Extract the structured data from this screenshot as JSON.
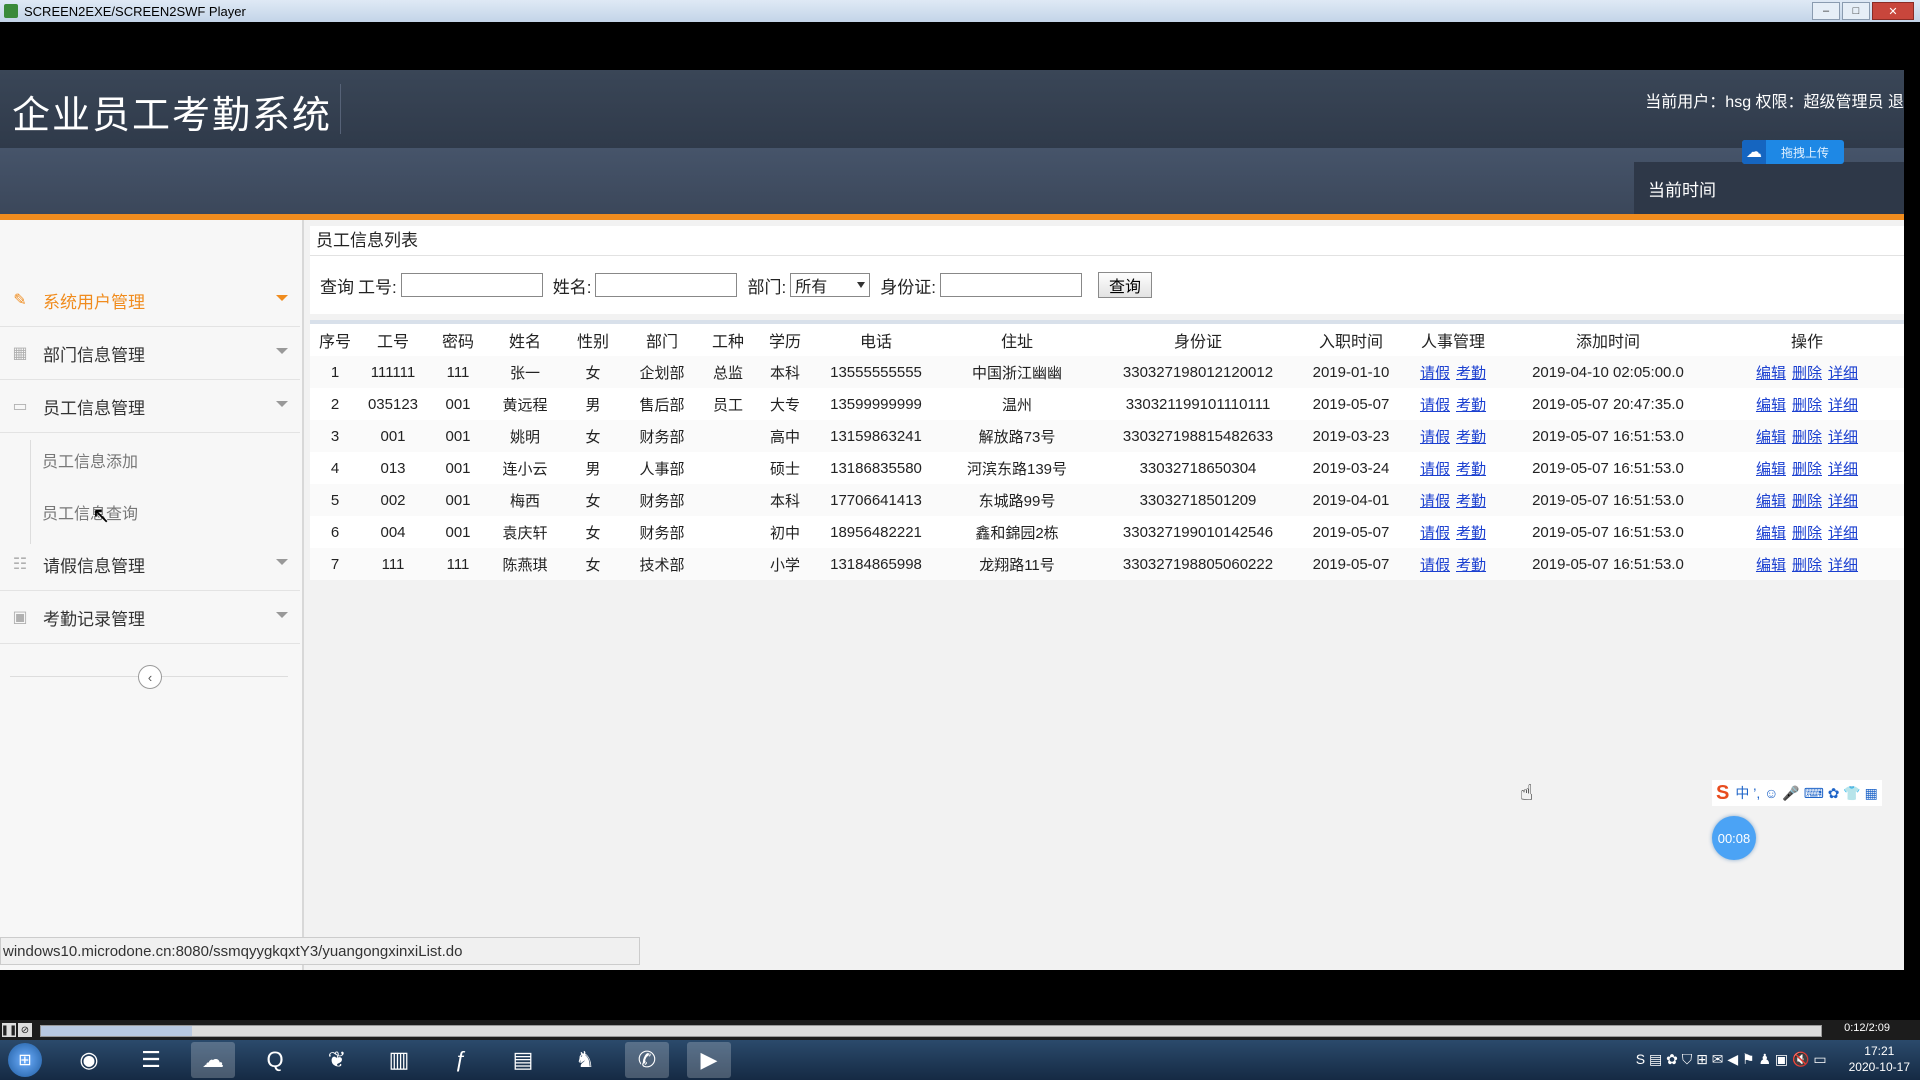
{
  "window": {
    "title": "SCREEN2EXE/SCREEN2SWF Player",
    "min": "–",
    "max": "□",
    "close": "✕"
  },
  "header": {
    "logo": "企业员工考勤系统",
    "user_info": "当前用户：hsg 权限：超级管理员 退",
    "upload": "拖拽上传",
    "time_label": "当前时间"
  },
  "sidebar": {
    "items": [
      {
        "label": "系统用户管理",
        "icon": "pencil-icon",
        "active": true
      },
      {
        "label": "部门信息管理",
        "icon": "grid-icon"
      },
      {
        "label": "员工信息管理",
        "icon": "monitor-icon"
      },
      {
        "label": "请假信息管理",
        "icon": "list-icon"
      },
      {
        "label": "考勤记录管理",
        "icon": "calendar-icon"
      }
    ],
    "sub_items": [
      "员工信息添加",
      "员工信息查询"
    ],
    "collapse": "‹"
  },
  "main": {
    "panel_title": "员工信息列表",
    "search": {
      "query_label": "查询",
      "id_label": "工号:",
      "name_label": "姓名:",
      "dept_label": "部门:",
      "dept_value": "所有",
      "idcard_label": "身份证:",
      "button": "查询"
    },
    "columns": [
      "序号",
      "工号",
      "密码",
      "姓名",
      "性别",
      "部门",
      "工种",
      "学历",
      "电话",
      "住址",
      "身份证",
      "入职时间",
      "人事管理",
      "添加时间",
      "操作"
    ],
    "rows": [
      [
        "1",
        "111111",
        "111",
        "张一",
        "女",
        "企划部",
        "总监",
        "本科",
        "13555555555",
        "中国浙江幽幽",
        "330327198012120012",
        "2019-01-10",
        "请假|考勤",
        "2019-04-10 02:05:00.0",
        "编辑|删除|详细"
      ],
      [
        "2",
        "035123",
        "001",
        "黄远程",
        "男",
        "售后部",
        "员工",
        "大专",
        "13599999999",
        "温州",
        "330321199101110111",
        "2019-05-07",
        "请假|考勤",
        "2019-05-07 20:47:35.0",
        "编辑|删除|详细"
      ],
      [
        "3",
        "001",
        "001",
        "姚明",
        "女",
        "财务部",
        "",
        "高中",
        "13159863241",
        "解放路73号",
        "330327198815482633",
        "2019-03-23",
        "请假|考勤",
        "2019-05-07 16:51:53.0",
        "编辑|删除|详细"
      ],
      [
        "4",
        "013",
        "001",
        "连小云",
        "男",
        "人事部",
        "",
        "硕士",
        "13186835580",
        "河滨东路139号",
        "33032718650304",
        "2019-03-24",
        "请假|考勤",
        "2019-05-07 16:51:53.0",
        "编辑|删除|详细"
      ],
      [
        "5",
        "002",
        "001",
        "梅西",
        "女",
        "财务部",
        "",
        "本科",
        "17706641413",
        "东城路99号",
        "33032718501209",
        "2019-04-01",
        "请假|考勤",
        "2019-05-07 16:51:53.0",
        "编辑|删除|详细"
      ],
      [
        "6",
        "004",
        "001",
        "袁庆轩",
        "女",
        "财务部",
        "",
        "初中",
        "18956482221",
        "鑫和錦园2栋",
        "330327199010142546",
        "2019-05-07",
        "请假|考勤",
        "2019-05-07 16:51:53.0",
        "编辑|删除|详细"
      ],
      [
        "7",
        "111",
        "111",
        "陈燕琪",
        "女",
        "技术部",
        "",
        "小学",
        "13184865998",
        "龙翔路11号",
        "330327198805060222",
        "2019-05-07",
        "请假|考勤",
        "2019-05-07 16:51:53.0",
        "编辑|删除|详细"
      ]
    ]
  },
  "status_url": "windows10.microdone.cn:8080/ssmqyygkqxtY3/yuangongxinxiList.do",
  "ime": {
    "logo": "S",
    "mode": "中 ’, ☺ 🎤 ⌨ ✿ 👕 ▦"
  },
  "rec_timer": "00:08",
  "player": {
    "time": "0:12/2:09",
    "progress": 0.085
  },
  "taskbar": {
    "apps": [
      "chrome-icon",
      "menu-icon",
      "baidu-icon",
      "browser-icon",
      "leaf-icon",
      "chart-icon",
      "flash-icon",
      "folder-icon",
      "qq-icon",
      "wechat-icon",
      "player-icon"
    ],
    "tray": "S ▤ ✿ ⛉ ⊞ ✉ ◀ ⚑ ♟ ▣ 🔇 ▭",
    "time": "17:21",
    "date": "2020-10-17"
  }
}
